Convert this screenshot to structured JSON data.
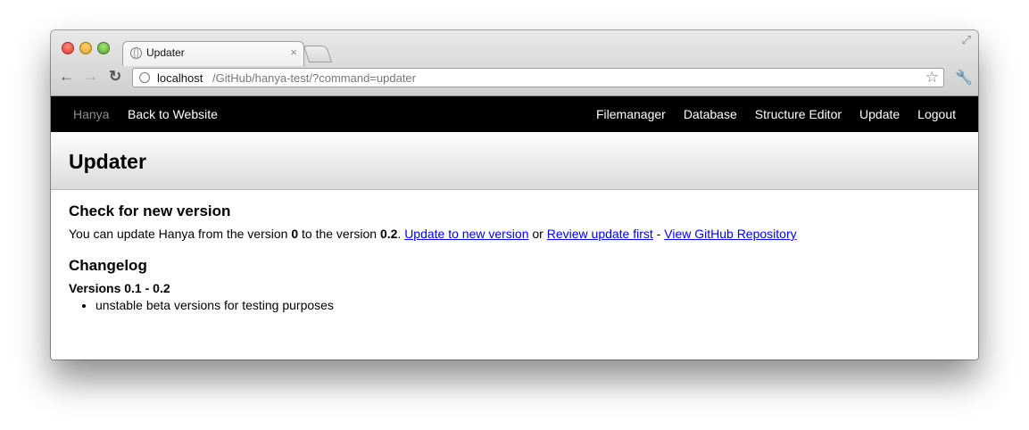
{
  "browser": {
    "tab_title": "Updater",
    "url_host": "localhost",
    "url_path": "/GitHub/hanya-test/?command=updater"
  },
  "navbar": {
    "brand": "Hanya",
    "back_link": "Back to Website",
    "items": [
      "Filemanager",
      "Database",
      "Structure Editor",
      "Update",
      "Logout"
    ]
  },
  "page": {
    "title": "Updater",
    "check_heading": "Check for new version",
    "update_text_1": "You can update Hanya from the version ",
    "current_version": "0",
    "update_text_2": " to the version ",
    "new_version": "0.2",
    "update_text_3": ". ",
    "link_update": "Update to new version",
    "text_or": " or ",
    "link_review": "Review update first",
    "text_dash": " - ",
    "link_github": "View GitHub Repository",
    "changelog_heading": "Changelog",
    "versions_label": "Versions 0.1 - 0.2",
    "changes": [
      "unstable beta versions for testing purposes"
    ]
  }
}
